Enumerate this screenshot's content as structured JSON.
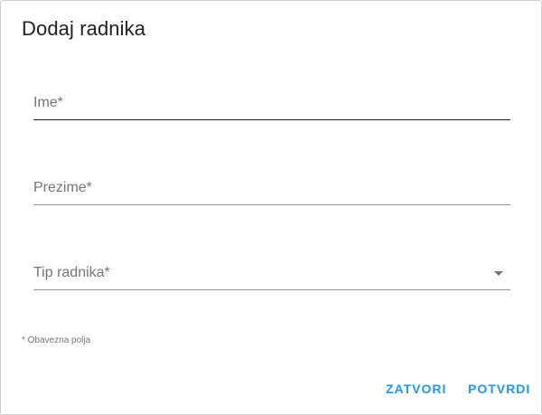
{
  "dialog": {
    "title": "Dodaj radnika",
    "fields": {
      "first_name": {
        "label": "Ime*",
        "value": ""
      },
      "last_name": {
        "label": "Prezime*",
        "value": ""
      },
      "worker_type": {
        "label": "Tip radnika*",
        "value": "",
        "icon": "arrow-drop-down-icon"
      }
    },
    "helper_text": "* Obavezna polja",
    "actions": {
      "close_label": "ZATVORI",
      "confirm_label": "POTVRDI"
    },
    "colors": {
      "accent": "#2196f3",
      "title": "#212121",
      "label": "#757575"
    }
  }
}
